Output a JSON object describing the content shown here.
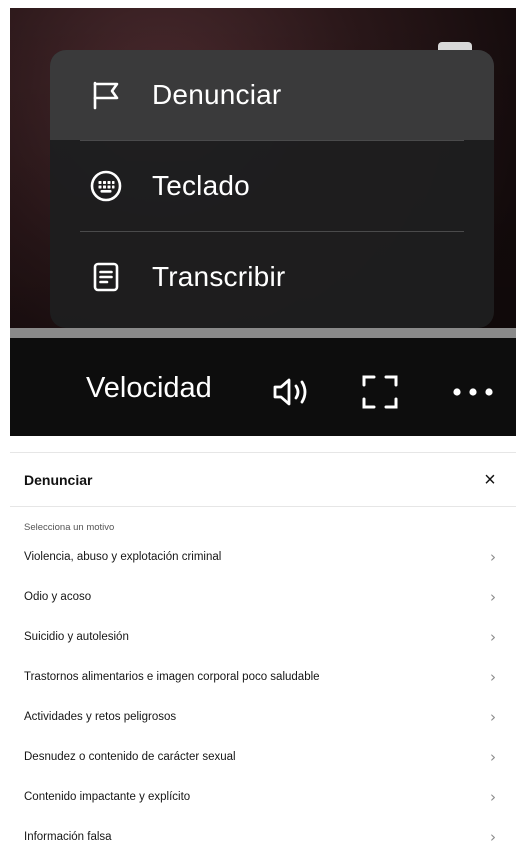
{
  "player_menu": {
    "items": [
      {
        "label": "Denunciar",
        "icon": "flag-icon",
        "active": true
      },
      {
        "label": "Teclado",
        "icon": "keyboard-icon",
        "active": false
      },
      {
        "label": "Transcribir",
        "icon": "transcript-icon",
        "active": false
      }
    ]
  },
  "controls": {
    "speed_label": "Velocidad",
    "volume_icon": "volume-icon",
    "fullscreen_icon": "fullscreen-icon",
    "more_icon": "more-icon"
  },
  "report_sheet": {
    "title": "Denunciar",
    "close_symbol": "×",
    "subtitle": "Selecciona un motivo",
    "reasons": [
      "Violencia, abuso y explotación criminal",
      "Odio y acoso",
      "Suicidio y autolesión",
      "Trastornos alimentarios e imagen corporal poco saludable",
      "Actividades y retos peligrosos",
      "Desnudez o contenido de carácter sexual",
      "Contenido impactante y explícito",
      "Información falsa"
    ]
  }
}
